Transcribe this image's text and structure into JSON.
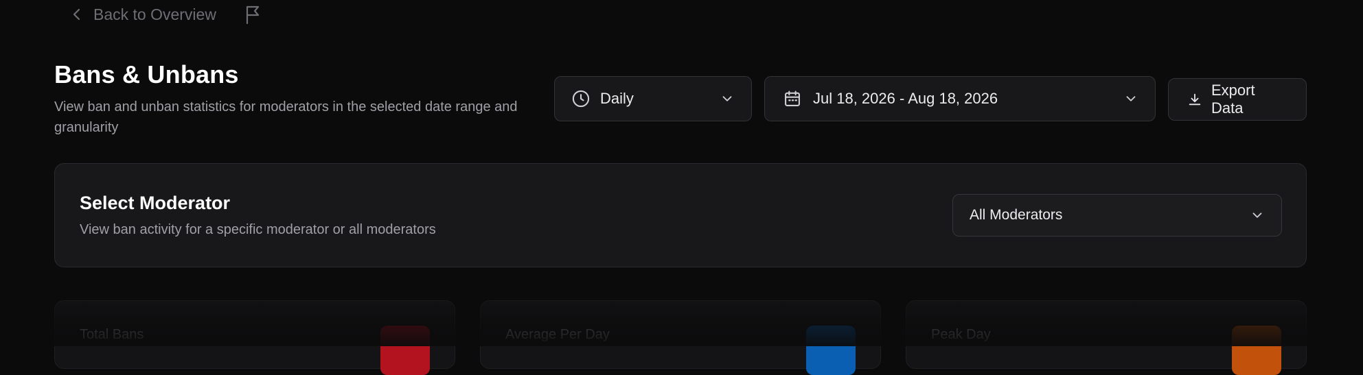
{
  "nav": {
    "back_label": "Back to Overview"
  },
  "header": {
    "title": "Bans & Unbans",
    "description": "View ban and unban statistics for moderators in the selected date range and granularity"
  },
  "controls": {
    "granularity": "Daily",
    "date_range": "Jul 18, 2026 - Aug 18, 2026",
    "export_label": "Export Data"
  },
  "moderator_card": {
    "title": "Select Moderator",
    "description": "View ban activity for a specific moderator or all moderators",
    "selected": "All Moderators"
  },
  "stats": [
    {
      "label": "Total Bans",
      "icon": "ban-icon",
      "color": "#b3121f"
    },
    {
      "label": "Average Per Day",
      "icon": "trend-icon",
      "color": "#0b5fb3"
    },
    {
      "label": "Peak Day",
      "icon": "peak-icon",
      "color": "#c2520b"
    }
  ],
  "colors": {
    "background": "#0b0b0c",
    "card": "#18181b",
    "border": "#333338",
    "muted_text": "#a0a0a6"
  }
}
